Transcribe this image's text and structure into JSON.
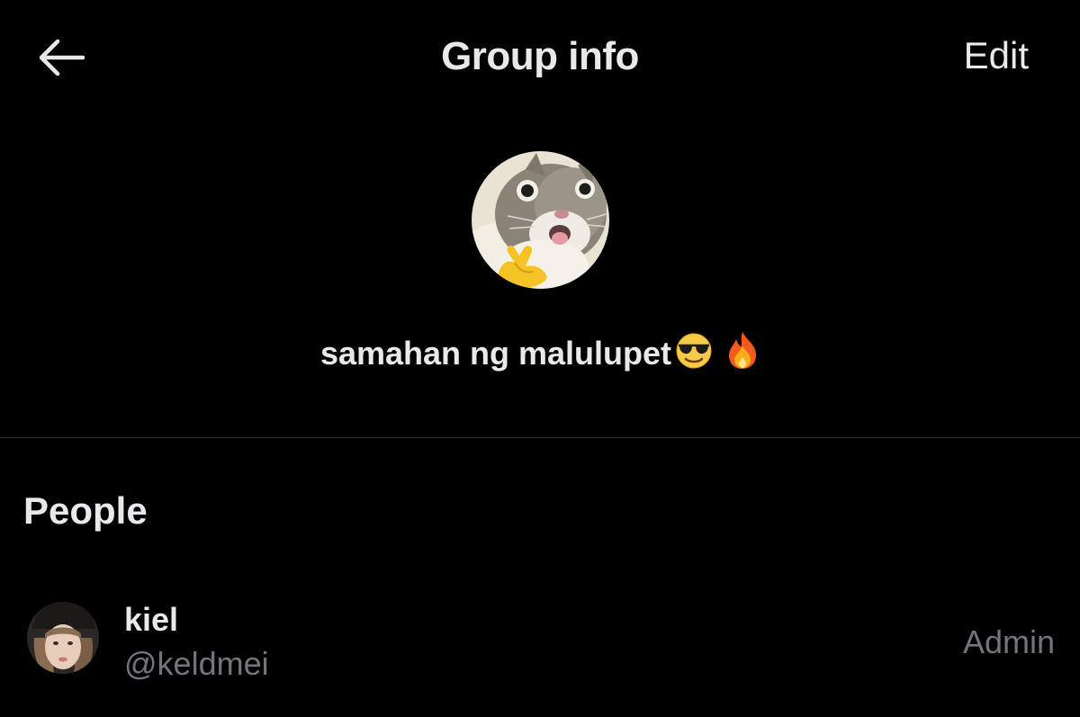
{
  "header": {
    "back_icon": "arrow-left-icon",
    "title": "Group info",
    "edit_label": "Edit"
  },
  "group": {
    "avatar": "cat-photo-avatar",
    "name": "samahan ng malulupet",
    "name_emojis": [
      "smiling-face-with-sunglasses",
      "fire"
    ]
  },
  "people": {
    "section_title": "People",
    "members": [
      {
        "name": "kiel",
        "handle": "@keldmei",
        "role": "Admin",
        "avatar": "profile-photo-avatar"
      }
    ]
  },
  "colors": {
    "background": "#000000",
    "primary_text": "#e7e9ea",
    "secondary_text": "#71767b",
    "divider": "#2f3336"
  }
}
